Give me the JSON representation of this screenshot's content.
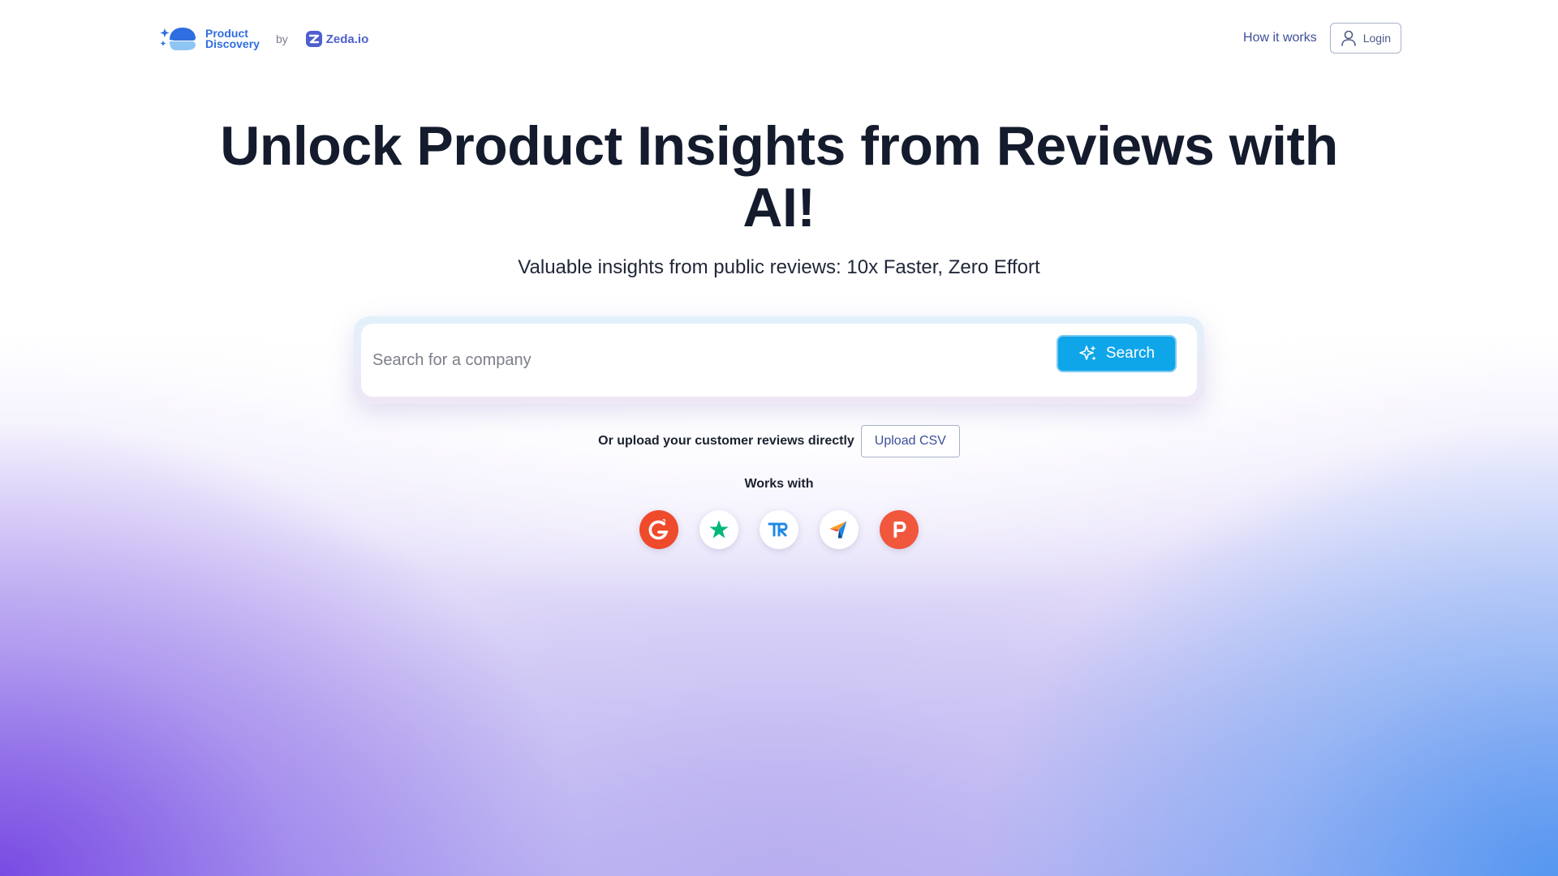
{
  "header": {
    "brand_line1": "Product",
    "brand_line2": "Discovery",
    "by_label": "by",
    "partner_name": "Zeda.io",
    "nav_link": "How it works",
    "login_label": "Login"
  },
  "hero": {
    "title": "Unlock Product Insights from Reviews with AI!",
    "subtitle": "Valuable insights from public reviews: 10x Faster, Zero Effort"
  },
  "search": {
    "placeholder": "Search for a company",
    "value": "",
    "button_label": "Search"
  },
  "upload": {
    "prompt": "Or upload your customer reviews directly",
    "button_label": "Upload CSV"
  },
  "works_with": {
    "label": "Works with",
    "sources": [
      {
        "name": "g2-icon",
        "color": "#ef4a2b"
      },
      {
        "name": "trustpilot-star-icon",
        "color": "#00b67a"
      },
      {
        "name": "trustradius-icon",
        "color": "#1e88e5"
      },
      {
        "name": "capterra-icon",
        "color": "#ff9d28"
      },
      {
        "name": "producthunt-icon",
        "color": "#f0573d"
      }
    ]
  },
  "colors": {
    "accent": "#0ea5e9",
    "brand": "#2f6ee0",
    "title": "#141b2d"
  }
}
